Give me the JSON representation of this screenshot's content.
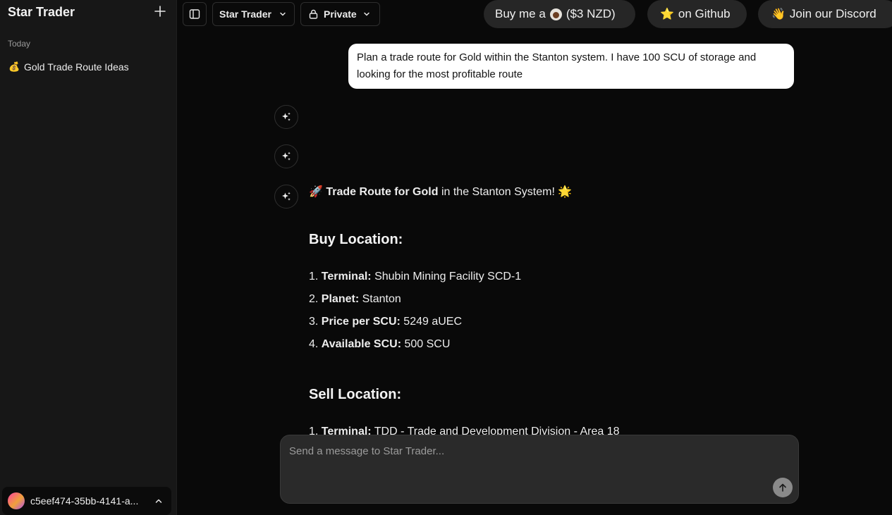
{
  "sidebar": {
    "app_title": "Star Trader",
    "section_label": "Today",
    "chats": [
      {
        "emoji": "💰",
        "label": "Gold Trade Route Ideas"
      }
    ],
    "user": {
      "name": "c5eef474-35bb-4141-a..."
    }
  },
  "header": {
    "model_label": "Star Trader",
    "visibility_label": "Private",
    "coffee": {
      "prefix": "Buy me a",
      "suffix": "($3 NZD)"
    },
    "github": {
      "emoji": "⭐",
      "label": "on Github"
    },
    "discord": {
      "emoji": "👋",
      "label": "Join our Discord"
    }
  },
  "chat": {
    "user_message": "Plan a trade route for Gold within the Stanton system. I have 100 SCU of storage and looking for the most profitable route",
    "reply": {
      "lead_emoji": "🚀",
      "bold": "Trade Route for Gold",
      "rest": " in the Stanton System! ",
      "trail_emoji": "🌟",
      "buy_heading": "Buy Location:",
      "buy_items": [
        {
          "num": "1.",
          "key": "Terminal:",
          "value": " Shubin Mining Facility SCD-1"
        },
        {
          "num": "2.",
          "key": "Planet:",
          "value": " Stanton"
        },
        {
          "num": "3.",
          "key": "Price per SCU:",
          "value": " 5249 aUEC"
        },
        {
          "num": "4.",
          "key": "Available SCU:",
          "value": " 500 SCU"
        }
      ],
      "sell_heading": "Sell Location:",
      "sell_items": [
        {
          "num": "1.",
          "key": "Terminal:",
          "value": " TDD - Trade and Development Division - Area 18"
        }
      ]
    }
  },
  "composer": {
    "placeholder": "Send a message to Star Trader..."
  },
  "icons": {
    "new_chat": "plus-icon",
    "sidebar_toggle": "sidebar-toggle-icon",
    "model_dropdown": "chevron-down-icon",
    "lock": "lock-icon",
    "assistant": "sparkles-icon",
    "send": "arrow-up-icon",
    "user_menu": "chevron-up-icon"
  }
}
